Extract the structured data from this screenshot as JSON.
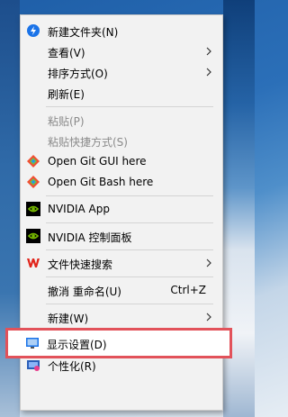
{
  "menu": {
    "new_folder": "新建文件夹(N)",
    "view": "查看(V)",
    "sort_by": "排序方式(O)",
    "refresh": "刷新(E)",
    "paste": "粘贴(P)",
    "paste_shortcut": "粘贴快捷方式(S)",
    "git_gui": "Open Git GUI here",
    "git_bash": "Open Git Bash here",
    "nvidia_app": "NVIDIA App",
    "nvidia_control": "NVIDIA 控制面板",
    "file_search": "文件快速搜索",
    "undo_rename": "撤消 重命名(U)",
    "undo_shortcut": "Ctrl+Z",
    "new": "新建(W)",
    "display_settings": "显示设置(D)",
    "personalize": "个性化(R)"
  },
  "icons": {
    "new_folder": "lightning-circle-icon",
    "git": "git-diamond-icon",
    "nvidia": "nvidia-icon",
    "wps": "wps-icon",
    "display": "monitor-icon",
    "personalize": "personalize-icon",
    "submenu": "chevron-right-icon"
  },
  "colors": {
    "menu_bg": "#f2f2f2",
    "highlight_border": "#e2525a",
    "disabled_text": "#8a8a8a",
    "nvidia_green": "#76b900",
    "wps_red": "#e1251b",
    "accent_blue": "#1a73e8"
  }
}
